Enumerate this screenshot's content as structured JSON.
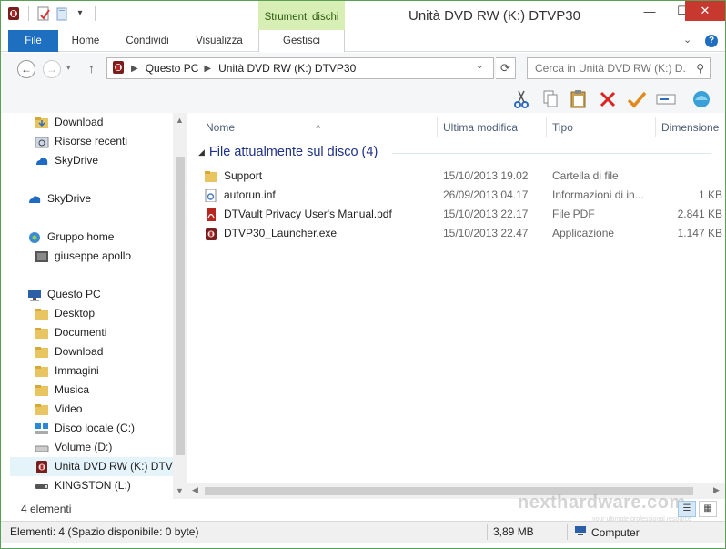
{
  "window": {
    "title": "Unità DVD RW (K:) DTVP30",
    "context_tab_group": "Strumenti dischi",
    "min_label": "—",
    "max_label": "☐",
    "close_label": "✕"
  },
  "ribbon": {
    "tabs": [
      "File",
      "Home",
      "Condividi",
      "Visualizza",
      "Gestisci"
    ],
    "help_label": "?",
    "expand_label": "⌄"
  },
  "address": {
    "crumbs": [
      "Questo PC",
      "Unità DVD RW (K:) DTVP30"
    ],
    "search_placeholder": "Cerca in Unità DVD RW (K:) D..."
  },
  "toolbar": {
    "icons": [
      "scissors-icon",
      "copy-icon",
      "paste-icon",
      "delete-icon",
      "checkmark-icon",
      "rename-icon",
      "shell-icon"
    ]
  },
  "nav": {
    "items": [
      {
        "label": "Download",
        "icon": "folder-download-icon"
      },
      {
        "label": "Risorse recenti",
        "icon": "recent-places-icon"
      },
      {
        "label": "SkyDrive",
        "icon": "skydrive-icon"
      },
      {
        "label": "SkyDrive",
        "icon": "skydrive-icon"
      },
      {
        "label": "Gruppo home",
        "icon": "homegroup-icon"
      },
      {
        "label": "giuseppe apollo",
        "icon": "user-icon"
      },
      {
        "label": "Questo PC",
        "icon": "computer-icon"
      },
      {
        "label": "Desktop",
        "icon": "folder-icon"
      },
      {
        "label": "Documenti",
        "icon": "folder-icon"
      },
      {
        "label": "Download",
        "icon": "folder-icon"
      },
      {
        "label": "Immagini",
        "icon": "folder-icon"
      },
      {
        "label": "Musica",
        "icon": "folder-icon"
      },
      {
        "label": "Video",
        "icon": "folder-icon"
      },
      {
        "label": "Disco locale (C:)",
        "icon": "drive-icon"
      },
      {
        "label": "Volume (D:)",
        "icon": "drive-icon"
      },
      {
        "label": "Unità DVD RW (K:) DTVP",
        "icon": "dtvp-drive-icon"
      },
      {
        "label": "KINGSTON (L:)",
        "icon": "usb-drive-icon"
      }
    ],
    "item_count": "4 elementi"
  },
  "content": {
    "columns": [
      "Nome",
      "Ultima modifica",
      "Tipo",
      "Dimensione"
    ],
    "group_label": "File attualmente sul disco (4)",
    "files": [
      {
        "name": "Support",
        "date": "15/10/2013 19.02",
        "type": "Cartella di file",
        "size": "",
        "icon": "folder-icon"
      },
      {
        "name": "autorun.inf",
        "date": "26/09/2013 04.17",
        "type": "Informazioni di in...",
        "size": "1 KB",
        "icon": "settings-file-icon"
      },
      {
        "name": "DTVault Privacy User's Manual.pdf",
        "date": "15/10/2013 22.17",
        "type": "File PDF",
        "size": "2.841 KB",
        "icon": "pdf-icon"
      },
      {
        "name": "DTVP30_Launcher.exe",
        "date": "15/10/2013 22.47",
        "type": "Applicazione",
        "size": "1.147 KB",
        "icon": "dtvp-app-icon"
      }
    ]
  },
  "status": {
    "elements": "Elementi: 4 (Spazio disponibile: 0 byte)",
    "size": "3,89 MB",
    "location": "Computer"
  },
  "watermark": {
    "text": "nexthardware.com",
    "sub": "your ultimate professional resource"
  },
  "colors": {
    "file_tab": "#1e6fc0",
    "context_tab": "#d7efb4",
    "close_button": "#c7382e",
    "group_heading": "#1e3287",
    "selection": "#e5f3fb"
  }
}
